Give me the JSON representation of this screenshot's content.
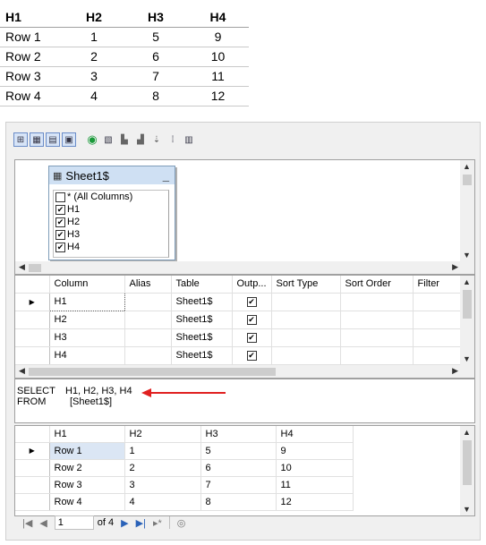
{
  "excel": {
    "headers": [
      "H1",
      "H2",
      "H3",
      "H4"
    ],
    "rows": [
      [
        "Row 1",
        "1",
        "5",
        "9"
      ],
      [
        "Row 2",
        "2",
        "6",
        "10"
      ],
      [
        "Row 3",
        "3",
        "7",
        "11"
      ],
      [
        "Row 4",
        "4",
        "8",
        "12"
      ]
    ]
  },
  "toolbar": {
    "icons": [
      "diagram-pane-icon",
      "criteria-pane-icon",
      "sql-pane-icon",
      "results-pane-icon",
      "run-icon",
      "verify-sql-icon",
      "group-by-icon",
      "sort-ascending-icon",
      "sort-descending-icon",
      "filter-icon",
      "add-table-icon"
    ]
  },
  "diagram": {
    "table_name": "Sheet1$",
    "columns": [
      {
        "label": "* (All Columns)",
        "checked": false
      },
      {
        "label": "H1",
        "checked": true
      },
      {
        "label": "H2",
        "checked": true
      },
      {
        "label": "H3",
        "checked": true
      },
      {
        "label": "H4",
        "checked": true
      }
    ]
  },
  "criteria": {
    "headers": [
      "Column",
      "Alias",
      "Table",
      "Outp...",
      "Sort Type",
      "Sort Order",
      "Filter"
    ],
    "rows": [
      {
        "column": "H1",
        "alias": "",
        "table": "Sheet1$",
        "output": true
      },
      {
        "column": "H2",
        "alias": "",
        "table": "Sheet1$",
        "output": true
      },
      {
        "column": "H3",
        "alias": "",
        "table": "Sheet1$",
        "output": true
      },
      {
        "column": "H4",
        "alias": "",
        "table": "Sheet1$",
        "output": true
      }
    ]
  },
  "sql": {
    "select_kw": "SELECT",
    "select_cols": "H1, H2, H3, H4",
    "from_kw": "FROM",
    "from_table": "[Sheet1$]"
  },
  "results": {
    "headers": [
      "H1",
      "H2",
      "H3",
      "H4"
    ],
    "rows": [
      [
        "Row 1",
        "1",
        "5",
        "9"
      ],
      [
        "Row 2",
        "2",
        "6",
        "10"
      ],
      [
        "Row 3",
        "3",
        "7",
        "11"
      ],
      [
        "Row 4",
        "4",
        "8",
        "12"
      ]
    ]
  },
  "navigator": {
    "current_page": "1",
    "of_label": "of 4"
  },
  "colors": {
    "arrow": "#e02020",
    "table_header": "#cfe0f3",
    "selected_cell": "#dbe6f4"
  }
}
